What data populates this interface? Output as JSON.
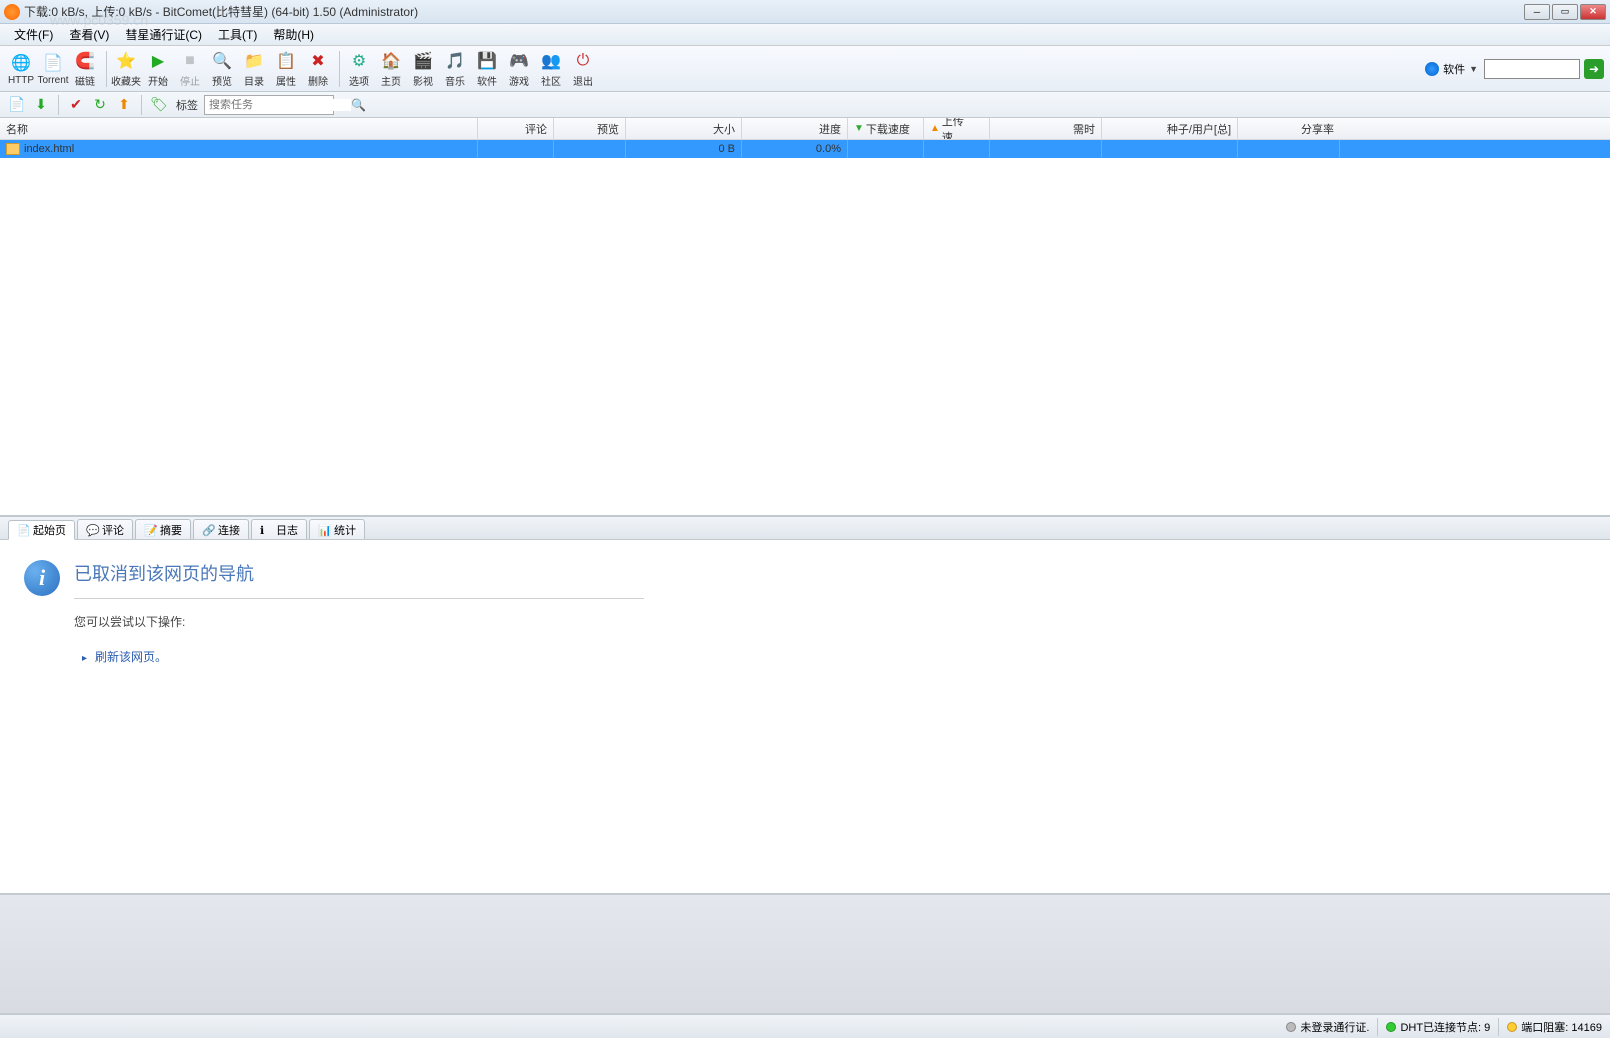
{
  "titlebar": {
    "text": "下载:0 kB/s, 上传:0 kB/s - BitComet(比特彗星) (64-bit) 1.50 (Administrator)"
  },
  "watermark": "www.pc0359.cn",
  "menu": {
    "file": "文件(F)",
    "view": "查看(V)",
    "passport": "彗星通行证(C)",
    "tools": "工具(T)",
    "help": "帮助(H)"
  },
  "toolbar": {
    "http": "HTTP",
    "torrent": "Torrent",
    "magnet": "磁链",
    "favorites": "收藏夹",
    "start": "开始",
    "stop": "停止",
    "preview": "预览",
    "files": "目录",
    "properties": "属性",
    "delete": "删除",
    "options": "选项",
    "home": "主页",
    "video": "影视",
    "music": "音乐",
    "software": "软件",
    "game": "游戏",
    "community": "社区",
    "exit": "退出",
    "search_cat": "软件"
  },
  "toolbar2": {
    "tags": "标签",
    "search_placeholder": "搜索任务"
  },
  "columns": {
    "name": "名称",
    "comment": "评论",
    "preview": "预览",
    "size": "大小",
    "progress": "进度",
    "dspeed": "下载速度",
    "uspeed": "上传速...",
    "time": "需时",
    "seeds": "种子/用户[总]",
    "share": "分享率"
  },
  "tasks": [
    {
      "name": "index.html",
      "size": "0 B",
      "progress": "0.0%"
    }
  ],
  "detail_tabs": {
    "start": "起始页",
    "comments": "评论",
    "summary": "摘要",
    "connections": "连接",
    "log": "日志",
    "stats": "统计"
  },
  "detail": {
    "heading": "已取消到该网页的导航",
    "suggestion": "您可以尝试以下操作:",
    "action": "刷新该网页。"
  },
  "status": {
    "passport": "未登录通行证.",
    "dht": "DHT已连接节点: 9",
    "port": "端口阻塞: 14169"
  }
}
